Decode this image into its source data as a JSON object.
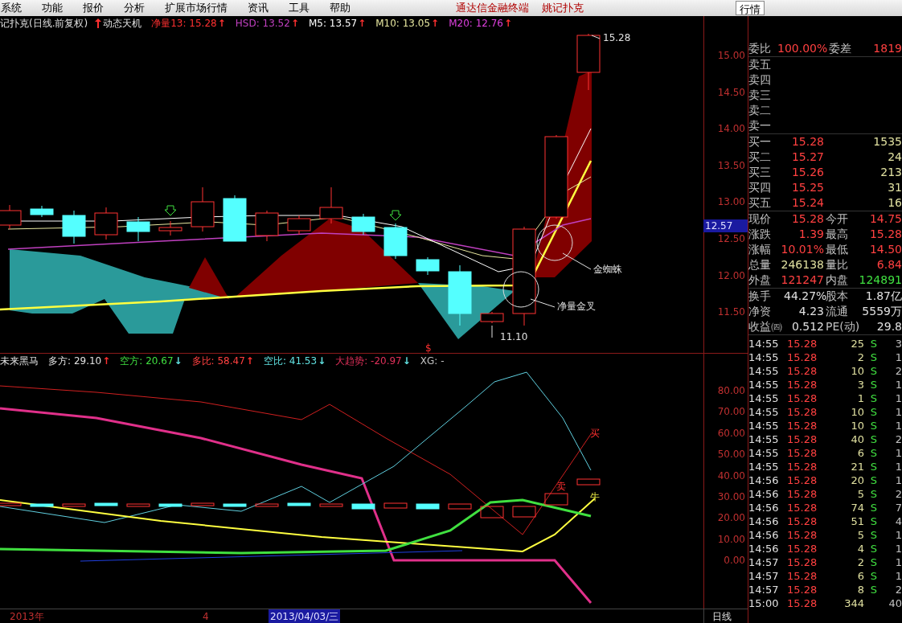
{
  "menu": [
    "系统",
    "功能",
    "报价",
    "分析",
    "扩展市场行情",
    "资讯",
    "工具",
    "帮助"
  ],
  "app_title": [
    "通达信金融终端",
    "姚记扑克"
  ],
  "view_tab": {
    "label": "行情",
    "selected": true
  },
  "main_chart": {
    "title": "记扑克(日线.前复权)",
    "indicator": "动态天机",
    "values": [
      {
        "label": "净量13:",
        "value": "15.28",
        "arrow": "↑",
        "color": "#ff3030"
      },
      {
        "label": "HSD:",
        "value": "13.52",
        "arrow": "↑",
        "color": "#c040c0"
      },
      {
        "label": "M5:",
        "value": "13.57",
        "arrow": "↑",
        "color": "#ffffff"
      },
      {
        "label": "M10:",
        "value": "13.05",
        "arrow": "↑",
        "color": "#e8e8a0"
      },
      {
        "label": "M20:",
        "value": "12.76",
        "arrow": "↑",
        "color": "#e040e0"
      }
    ],
    "ticks": [
      "15.00",
      "14.50",
      "14.00",
      "13.50",
      "13.00",
      "12.50",
      "12.00",
      "11.50"
    ],
    "current_price": "12.57",
    "annotations": [
      "15.28",
      "11.10",
      "金蜘蛛",
      "净量金叉",
      "$"
    ]
  },
  "indicator_chart": {
    "title": "未来黑马",
    "values": [
      {
        "label": "多方:",
        "value": "29.10",
        "arrow": "↑",
        "color": "#e0e0e0"
      },
      {
        "label": "空方:",
        "value": "20.67",
        "arrow": "↓",
        "color": "#40e040"
      },
      {
        "label": "多比:",
        "value": "58.47",
        "arrow": "↑",
        "color": "#ff4040"
      },
      {
        "label": "空比:",
        "value": "41.53",
        "arrow": "↓",
        "color": "#60e0e0"
      },
      {
        "label": "大趋势:",
        "value": "-20.97",
        "arrow": "↓",
        "color": "#e0305a"
      },
      {
        "label": "XG:",
        "value": "-",
        "color": "#c0c0c0"
      }
    ],
    "ticks": [
      "80.00",
      "70.00",
      "60.00",
      "50.00",
      "40.00",
      "30.00",
      "20.00",
      "10.00",
      "0.00"
    ],
    "annotations": [
      "买",
      "卖",
      "牛"
    ]
  },
  "time_axis": [
    "2013年",
    "4",
    "2013/04/03/三",
    "日线"
  ],
  "quote_panel": {
    "ratio": {
      "label": "委比",
      "value": "100.00%",
      "label2": "委差",
      "value2": "1819"
    },
    "asks": [
      {
        "label": "卖五"
      },
      {
        "label": "卖四"
      },
      {
        "label": "卖三"
      },
      {
        "label": "卖二"
      },
      {
        "label": "卖一"
      }
    ],
    "bids": [
      {
        "label": "买一",
        "price": "15.28",
        "volume": "1535"
      },
      {
        "label": "买二",
        "price": "15.27",
        "volume": "24"
      },
      {
        "label": "买三",
        "price": "15.26",
        "volume": "213"
      },
      {
        "label": "买四",
        "price": "15.25",
        "volume": "31"
      },
      {
        "label": "买五",
        "price": "15.24",
        "volume": "16"
      }
    ],
    "stats": [
      {
        "label": "现价",
        "value": "15.28",
        "color": "#ff4040"
      },
      {
        "label": "今开",
        "value": "14.75",
        "color": "#ff4040"
      },
      {
        "label": "涨跌",
        "value": "1.39",
        "color": "#ff4040"
      },
      {
        "label": "最高",
        "value": "15.28",
        "color": "#ff4040"
      },
      {
        "label": "涨幅",
        "value": "10.01%",
        "color": "#ff4040"
      },
      {
        "label": "最低",
        "value": "14.50",
        "color": "#ff4040"
      },
      {
        "label": "总量",
        "value": "246138",
        "color": "#e0e0a0"
      },
      {
        "label": "量比",
        "value": "6.84",
        "color": "#ff4040"
      },
      {
        "label": "外盘",
        "value": "121247",
        "color": "#ff4040"
      },
      {
        "label": "内盘",
        "value": "124891",
        "color": "#40e040"
      }
    ],
    "extra": [
      {
        "label": "换手",
        "value": "44.27%",
        "label2": "股本",
        "value2": "1.87亿"
      },
      {
        "label": "净资",
        "value": "4.23",
        "label2": "流通",
        "value2": "5559万"
      },
      {
        "label": "收益㈣",
        "value": "0.512",
        "label2": "PE(动)",
        "value2": "29.8"
      }
    ],
    "trades": [
      {
        "time": "14:55",
        "price": "15.28",
        "volume": "25",
        "side": "S",
        "count": "3"
      },
      {
        "time": "14:55",
        "price": "15.28",
        "volume": "2",
        "side": "S",
        "count": "1"
      },
      {
        "time": "14:55",
        "price": "15.28",
        "volume": "10",
        "side": "S",
        "count": "2"
      },
      {
        "time": "14:55",
        "price": "15.28",
        "volume": "3",
        "side": "S",
        "count": "1"
      },
      {
        "time": "14:55",
        "price": "15.28",
        "volume": "1",
        "side": "S",
        "count": "1"
      },
      {
        "time": "14:55",
        "price": "15.28",
        "volume": "10",
        "side": "S",
        "count": "1"
      },
      {
        "time": "14:55",
        "price": "15.28",
        "volume": "10",
        "side": "S",
        "count": "1"
      },
      {
        "time": "14:55",
        "price": "15.28",
        "volume": "40",
        "side": "S",
        "count": "2"
      },
      {
        "time": "14:55",
        "price": "15.28",
        "volume": "6",
        "side": "S",
        "count": "1"
      },
      {
        "time": "14:55",
        "price": "15.28",
        "volume": "21",
        "side": "S",
        "count": "1"
      },
      {
        "time": "14:56",
        "price": "15.28",
        "volume": "20",
        "side": "S",
        "count": "1"
      },
      {
        "time": "14:56",
        "price": "15.28",
        "volume": "5",
        "side": "S",
        "count": "2"
      },
      {
        "time": "14:56",
        "price": "15.28",
        "volume": "74",
        "side": "S",
        "count": "7"
      },
      {
        "time": "14:56",
        "price": "15.28",
        "volume": "51",
        "side": "S",
        "count": "4"
      },
      {
        "time": "14:56",
        "price": "15.28",
        "volume": "5",
        "side": "S",
        "count": "1"
      },
      {
        "time": "14:56",
        "price": "15.28",
        "volume": "4",
        "side": "S",
        "count": "1"
      },
      {
        "time": "14:57",
        "price": "15.28",
        "volume": "2",
        "side": "S",
        "count": "1"
      },
      {
        "time": "14:57",
        "price": "15.28",
        "volume": "6",
        "side": "S",
        "count": "1"
      },
      {
        "time": "14:57",
        "price": "15.28",
        "volume": "8",
        "side": "S",
        "count": "2"
      },
      {
        "time": "15:00",
        "price": "15.28",
        "volume": "344",
        "count": "40"
      }
    ]
  }
}
